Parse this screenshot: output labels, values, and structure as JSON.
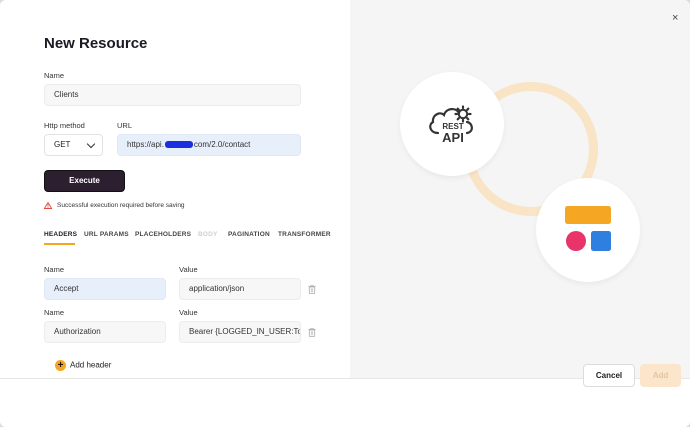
{
  "dialog": {
    "title": "New Resource",
    "close_symbol": "×"
  },
  "form": {
    "name_label": "Name",
    "name_value": "Clients",
    "method_label": "Http method",
    "method_value": "GET",
    "url_label": "URL",
    "url_prefix": "https://api.",
    "url_suffix": "com/2.0/contact",
    "execute_label": "Execute",
    "warning_text": "Successful execution required before saving"
  },
  "tabs": [
    {
      "label": "HEADERS",
      "state": "active"
    },
    {
      "label": "URL PARAMS",
      "state": "normal"
    },
    {
      "label": "PLACEHOLDERS",
      "state": "normal"
    },
    {
      "label": "BODY",
      "state": "disabled"
    },
    {
      "label": "PAGINATION",
      "state": "normal"
    },
    {
      "label": "TRANSFORMER",
      "state": "normal"
    }
  ],
  "headers": {
    "name_label": "Name",
    "value_label": "Value",
    "rows": [
      {
        "name": "Accept",
        "value": "application/json"
      },
      {
        "name": "Authorization",
        "value": "Bearer {LOGGED_IN_USER:To"
      }
    ],
    "add_label": "Add header",
    "add_icon_symbol": "+"
  },
  "illustration": {
    "rest_icon_line1": "REST",
    "rest_icon_line2": "API",
    "colors": {
      "ring": "#f9e4c6",
      "block_orange": "#f5a623",
      "dot_pink": "#e8336b",
      "square_blue": "#2f7fe0"
    }
  },
  "footer": {
    "cancel_label": "Cancel",
    "add_label": "Add"
  },
  "colors": {
    "accent": "#f5a623",
    "execute_bg": "#2c1f2f",
    "highlight_input": "#e7effb"
  }
}
